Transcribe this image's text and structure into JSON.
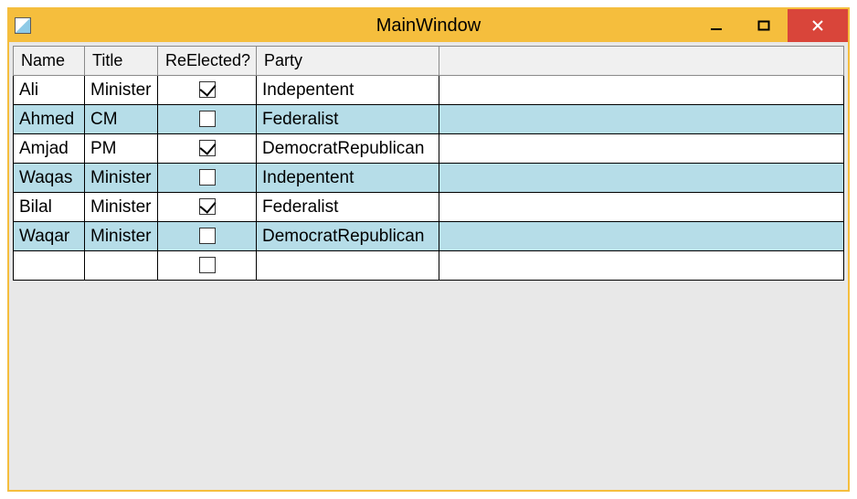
{
  "window": {
    "title": "MainWindow"
  },
  "columns": {
    "name": "Name",
    "title": "Title",
    "reelected": "ReElected?",
    "party": "Party"
  },
  "rows": [
    {
      "name": "Ali",
      "title": "Minister",
      "reelected": true,
      "party": "Indepentent"
    },
    {
      "name": "Ahmed",
      "title": "CM",
      "reelected": false,
      "party": "Federalist"
    },
    {
      "name": "Amjad",
      "title": "PM",
      "reelected": true,
      "party": "DemocratRepublican"
    },
    {
      "name": "Waqas",
      "title": "Minister",
      "reelected": false,
      "party": "Indepentent"
    },
    {
      "name": "Bilal",
      "title": "Minister",
      "reelected": true,
      "party": "Federalist"
    },
    {
      "name": "Waqar",
      "title": "Minister",
      "reelected": false,
      "party": "DemocratRepublican"
    }
  ],
  "new_row": {
    "name": "",
    "title": "",
    "reelected": false,
    "party": ""
  }
}
